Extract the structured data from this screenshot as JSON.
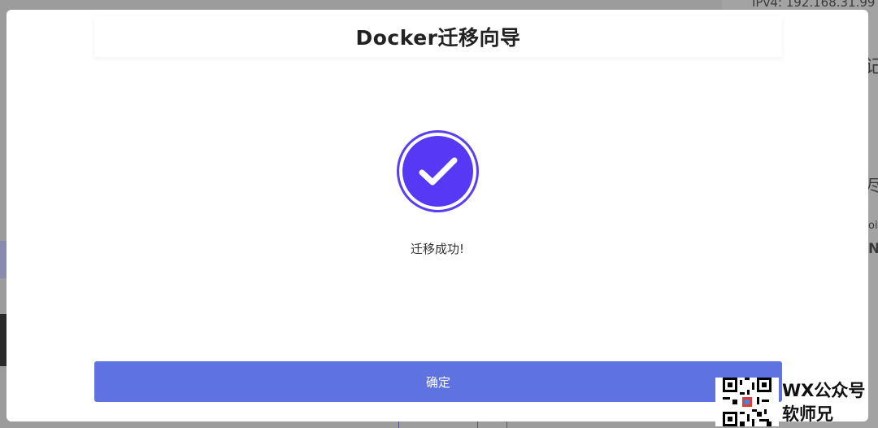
{
  "modal": {
    "title": "Docker迁移向导",
    "success_message": "迁移成功!",
    "confirm_label": "确定",
    "icon": "checkmark-circle-icon",
    "accent_color": "#5738f4",
    "button_color": "#5e73e0"
  },
  "background": {
    "ipv4_text": "IPv4:  192.168.31.99",
    "side_char_1": "记",
    "side_char_2": "尽",
    "side_char_3": "oit",
    "side_char_4": "N"
  },
  "watermark": {
    "line1": "WX公众号",
    "line2": "软师兄"
  }
}
